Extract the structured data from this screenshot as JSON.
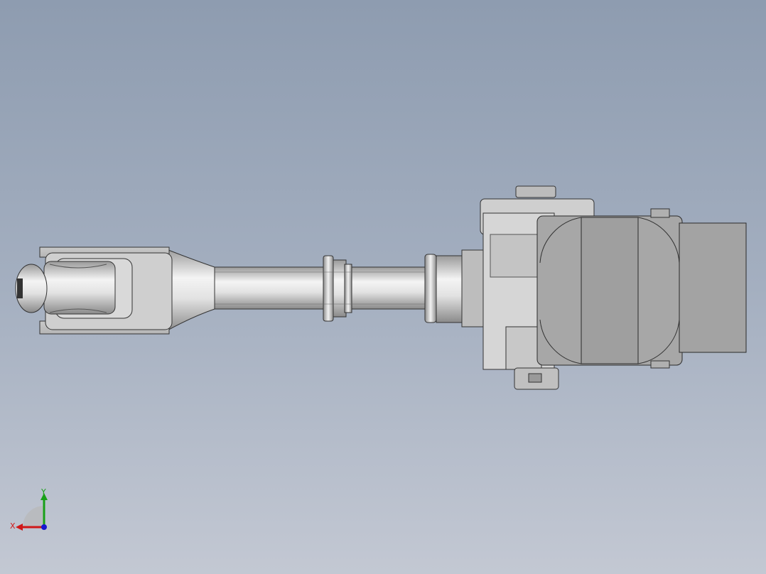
{
  "viewport": {
    "colors": {
      "bg_top": "#8e9cb0",
      "bg_bottom": "#c3c8d3",
      "part_light": "#ececec",
      "part_gray": "#a7a7a7",
      "edge": "#2a2a2a"
    }
  },
  "triad": {
    "x_label": "X",
    "y_label": "Y",
    "colors": {
      "x": "#d01818",
      "y": "#18a018",
      "z": "#1818d0"
    }
  }
}
